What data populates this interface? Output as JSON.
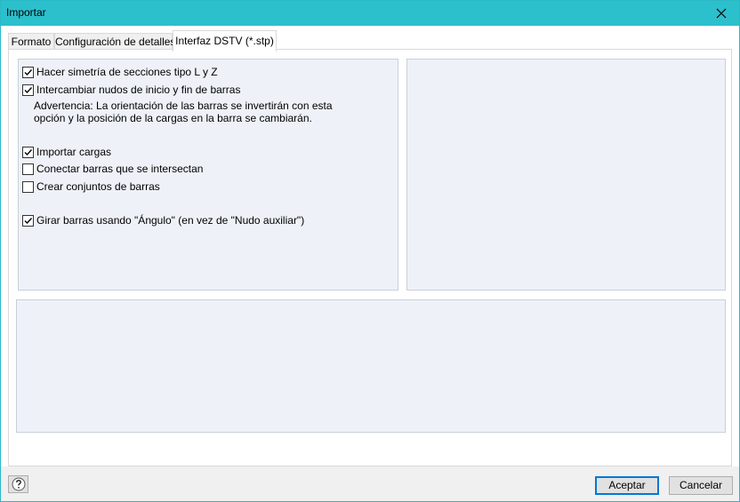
{
  "window": {
    "title": "Importar"
  },
  "tabs": [
    {
      "label": "Formato"
    },
    {
      "label": "Configuración de detalles"
    },
    {
      "label": "Interfaz DSTV (*.stp)",
      "active": true
    }
  ],
  "options": {
    "mirror_sections": {
      "label": "Hacer simetría de secciones tipo L y Z",
      "checked": true
    },
    "swap_nodes": {
      "label": "Intercambiar nudos de inicio y fin de barras",
      "checked": true
    },
    "warning_line1": "Advertencia: La orientación de las barras se invertirán con esta",
    "warning_line2": "opción y la posición de la cargas en la barra se cambiarán.",
    "import_loads": {
      "label": "Importar cargas",
      "checked": true
    },
    "connect_members": {
      "label": "Conectar barras que se intersectan",
      "checked": false
    },
    "create_sets": {
      "label": "Crear conjuntos de barras",
      "checked": false
    },
    "rotate_members": {
      "label": "Girar barras usando \"Ángulo\" (en vez de \"Nudo auxiliar\")",
      "checked": true
    }
  },
  "buttons": {
    "ok": "Aceptar",
    "cancel": "Cancelar"
  },
  "colors": {
    "titlebar": "#2cc0cd",
    "panel": "#eef2f8",
    "accent": "#0078d7"
  }
}
